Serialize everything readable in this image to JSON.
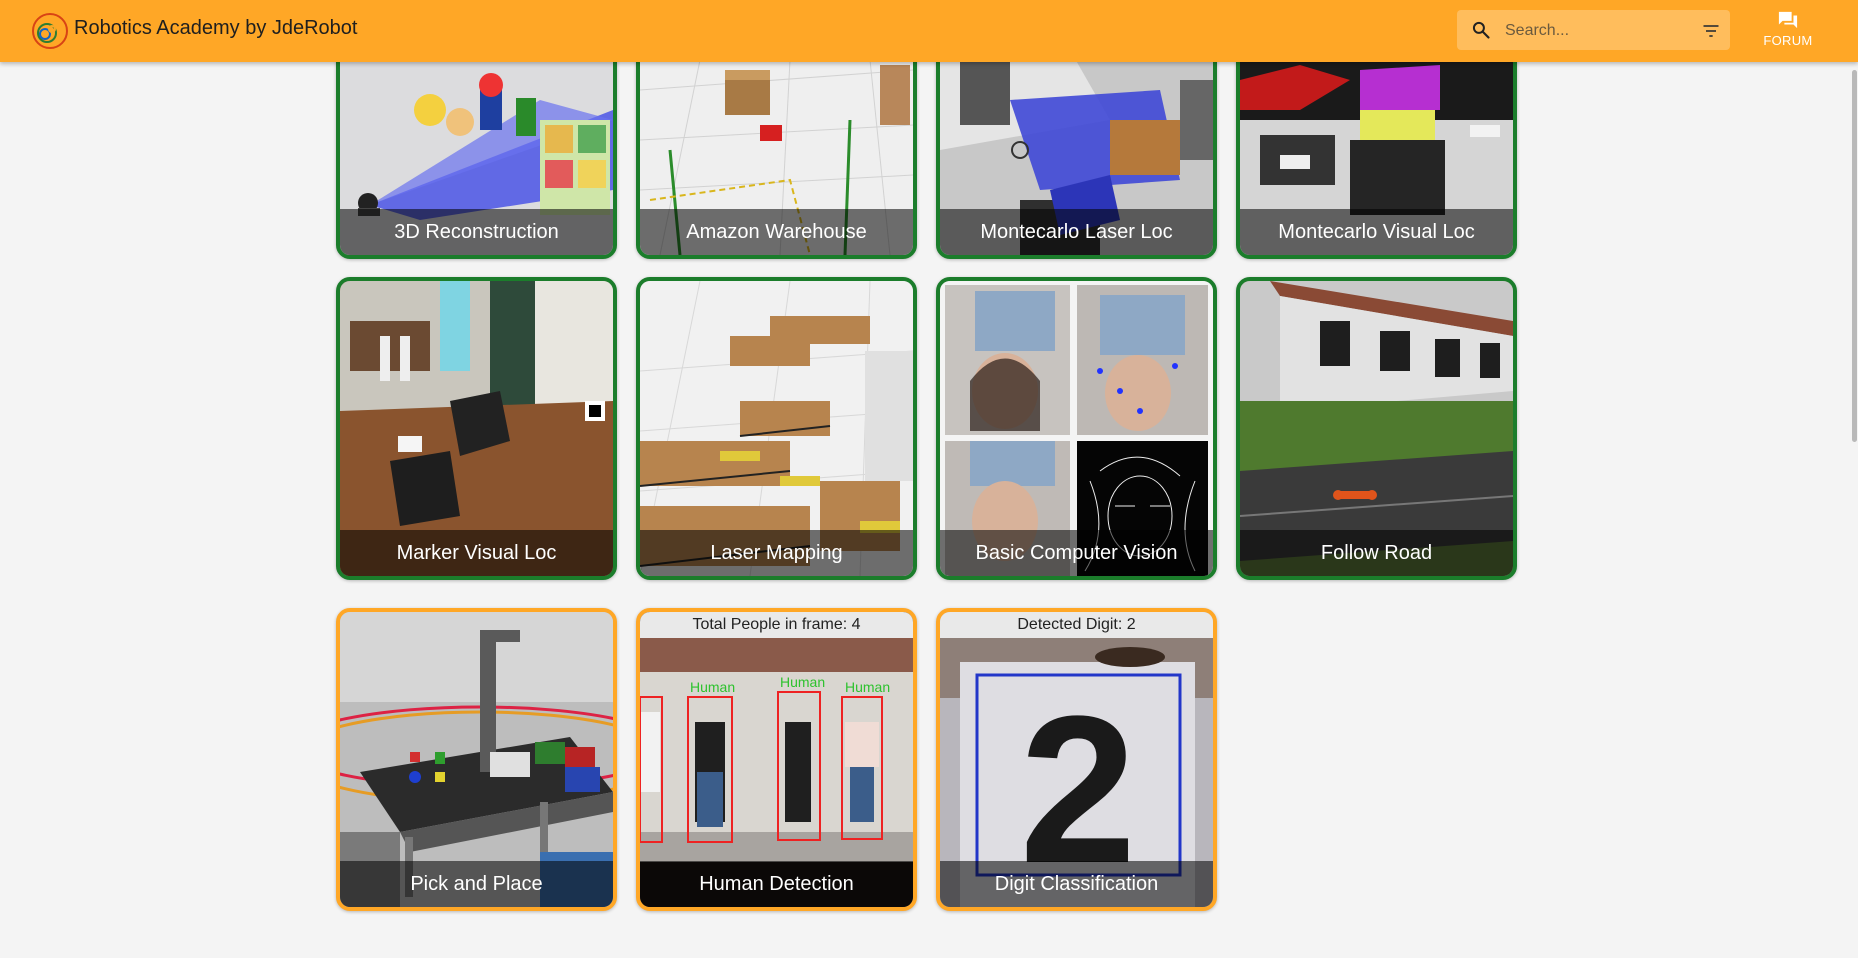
{
  "app": {
    "title": "Robotics Academy by JdeRobot"
  },
  "search": {
    "placeholder": "Search..."
  },
  "header": {
    "forum_label": "FORUM"
  },
  "colors": {
    "appbar": "#ffa726",
    "ready_border": "#1b7d2b",
    "wip_border": "#ffa726"
  },
  "exercises": [
    {
      "name": "3D Reconstruction"
    },
    {
      "name": "Amazon Warehouse"
    },
    {
      "name": "Montecarlo Laser Loc"
    },
    {
      "name": "Montecarlo Visual Loc"
    },
    {
      "name": "Marker Visual Loc"
    },
    {
      "name": "Laser Mapping"
    },
    {
      "name": "Basic Computer Vision"
    },
    {
      "name": "Follow Road"
    },
    {
      "name": "Pick and Place"
    },
    {
      "name": "Human Detection",
      "overlay": "Total People in frame: 4",
      "tag": "Human"
    },
    {
      "name": "Digit Classification",
      "overlay": "Detected Digit: 2",
      "digit": "2"
    }
  ]
}
